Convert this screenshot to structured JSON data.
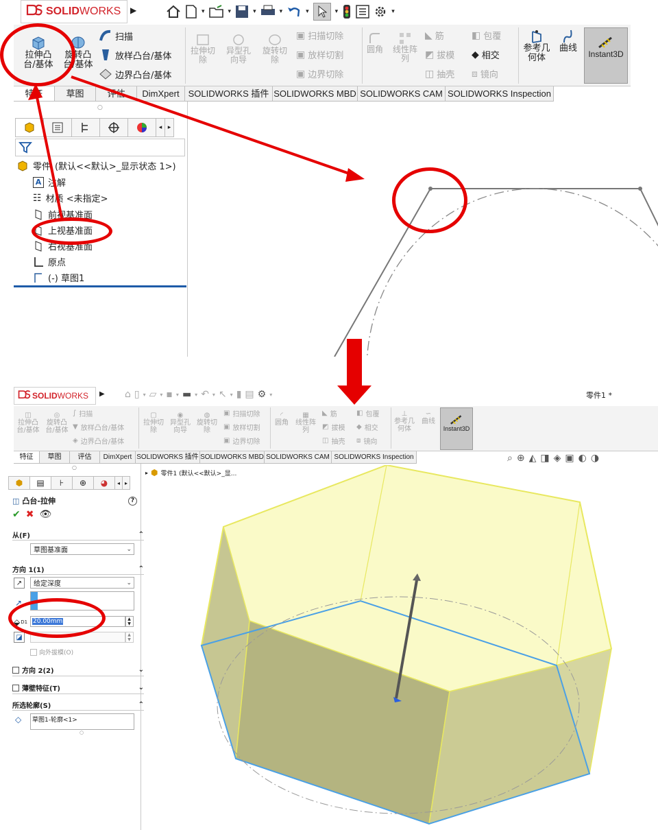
{
  "app": {
    "logo_ds": "3S",
    "logo_solid": "SOLID",
    "logo_works": "WORKS",
    "document_title": "零件1 *"
  },
  "colors": {
    "brand_red": "#d2232a",
    "annotation_red": "#e50000",
    "active_button": "#c7c7c7",
    "part_yellow": "#f3f29c",
    "sketch_blue": "#4aa0e6"
  },
  "ribbon": {
    "extrude_boss": "拉伸凸台/基体",
    "revolve_boss": "旋转凸台/基体",
    "sweep": "扫描",
    "loft_boss": "放样凸台/基体",
    "boundary_boss": "边界凸台/基体",
    "extrude_cut": "拉伸切除",
    "hole_wizard": "异型孔向导",
    "revolve_cut": "旋转切除",
    "sweep_cut": "扫描切除",
    "loft_cut": "放样切割",
    "boundary_cut": "边界切除",
    "fillet": "圆角",
    "linear_pattern": "线性阵列",
    "rib": "筋",
    "draft": "拔模",
    "shell": "抽壳",
    "wrap": "包覆",
    "intersect": "相交",
    "mirror": "镜向",
    "ref_geometry": "参考几何体",
    "curves": "曲线",
    "instant3d": "Instant3D"
  },
  "tabs": [
    "特征",
    "草图",
    "评估",
    "DimXpert",
    "SOLIDWORKS 插件",
    "SOLIDWORKS MBD",
    "SOLIDWORKS CAM",
    "SOLIDWORKS Inspection"
  ],
  "tree": {
    "root": "零件",
    "root_config": "(默认<<默认>_显示状态 1>)",
    "annotations": "注解",
    "material": "材质 <未指定>",
    "front_plane": "前视基准面",
    "top_plane": "上视基准面",
    "right_plane": "右视基准面",
    "origin": "原点",
    "sketch": "(-) 草图1"
  },
  "viewport_breadcrumb": "零件1 (默认<<默认>_显...",
  "property_manager": {
    "title": "凸台-拉伸",
    "help": "?",
    "from_header": "从(F)",
    "from_value": "草图基准面",
    "dir1_header": "方向 1(1)",
    "end_condition": "给定深度",
    "depth_value": "20.00mm",
    "depth_label": "D1",
    "draft_outward": "向外拔模(O)",
    "dir2_header": "方向 2(2)",
    "thin_feature": "薄壁特征(T)",
    "selected_contours_header": "所选轮廓(S)",
    "selected_contour": "草图1-轮廓<1>"
  },
  "icons": [
    "solidworks-logo-icon",
    "home-icon",
    "new-document-icon",
    "open-folder-icon",
    "save-icon",
    "print-icon",
    "undo-icon",
    "select-arrow-icon",
    "traffic-light-icon",
    "list-icon",
    "gear-icon",
    "extrude-icon",
    "revolve-icon",
    "sweep-icon",
    "loft-icon",
    "boundary-icon",
    "feature-tree-icon",
    "property-manager-icon",
    "configuration-icon",
    "dimxpert-icon",
    "display-manager-icon",
    "filter-icon",
    "part-icon",
    "annotation-icon",
    "material-icon",
    "plane-icon",
    "origin-icon",
    "sketch-icon",
    "ok-check-icon",
    "cancel-x-icon",
    "preview-eye-icon",
    "direction-arrow-icon",
    "depth-icon",
    "draft-icon",
    "contour-icon",
    "search-icon",
    "zoom-icon",
    "view-orientation-icon",
    "display-style-icon"
  ]
}
